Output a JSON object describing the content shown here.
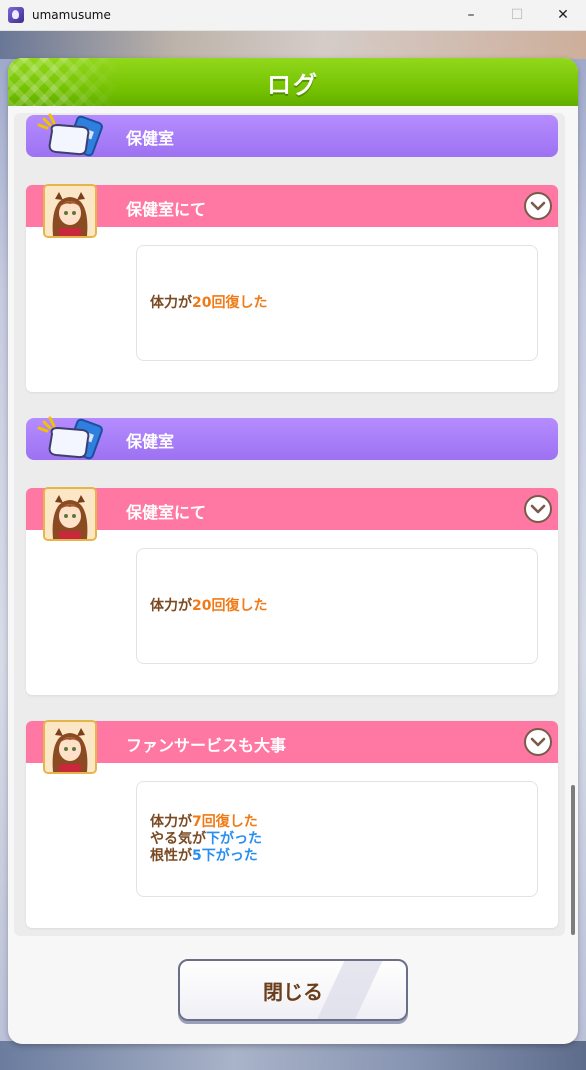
{
  "window": {
    "title": "umamusume",
    "controls": {
      "minimize": "–",
      "maximize": "☐",
      "close": "✕"
    }
  },
  "dialog": {
    "title": "ログ",
    "close_label": "閉じる"
  },
  "categories": [
    {
      "label": "保健室",
      "icon": "infirmary-icon"
    },
    {
      "label": "保健室",
      "icon": "infirmary-icon"
    }
  ],
  "events": [
    {
      "title": "保健室にて",
      "effects": [
        {
          "pre": "体力が",
          "value": "20回復した",
          "color": "orange"
        }
      ]
    },
    {
      "title": "保健室にて",
      "effects": [
        {
          "pre": "体力が",
          "value": "20回復した",
          "color": "orange"
        }
      ]
    },
    {
      "title": "ファンサービスも大事",
      "effects": [
        {
          "pre": "体力が",
          "value": "7回復した",
          "color": "orange"
        },
        {
          "pre": "やる気が",
          "value": "下がった",
          "color": "blue"
        },
        {
          "pre": "根性が",
          "value": "5下がった",
          "color": "blue"
        }
      ]
    }
  ],
  "colors": {
    "header_green": "#7ac800",
    "category_purple": "#a67bff",
    "event_pink": "#ff78a4",
    "value_orange": "#f07a16",
    "value_blue": "#2a8ef0"
  }
}
